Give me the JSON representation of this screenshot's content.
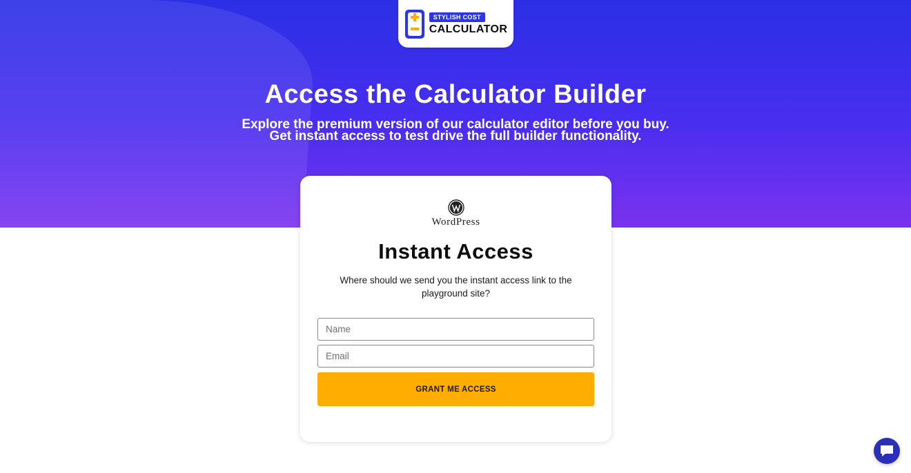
{
  "logo": {
    "tag": "STYLISH COST",
    "name": "CALCULATOR"
  },
  "hero": {
    "title": "Access the Calculator Builder",
    "subtitle_line1": "Explore the premium version of our calculator editor before you buy.",
    "subtitle_line2": "Get instant access to test drive the full builder functionality."
  },
  "card": {
    "wp_logo_text": "WordPress",
    "title": "Instant Access",
    "description": "Where should we send you the instant access link to the playground site?",
    "name_placeholder": "Name",
    "email_placeholder": "Email",
    "submit_label": "GRANT ME ACCESS"
  },
  "colors": {
    "hero_gradient_top": "#2b2fe6",
    "hero_gradient_bottom": "#7a33ee",
    "accent": "#ffae00",
    "brand_blue": "#2b36e6"
  },
  "icons": {
    "logo": "calculator-icon",
    "wordpress": "wordpress-icon",
    "chat": "chat-bubble-icon"
  }
}
